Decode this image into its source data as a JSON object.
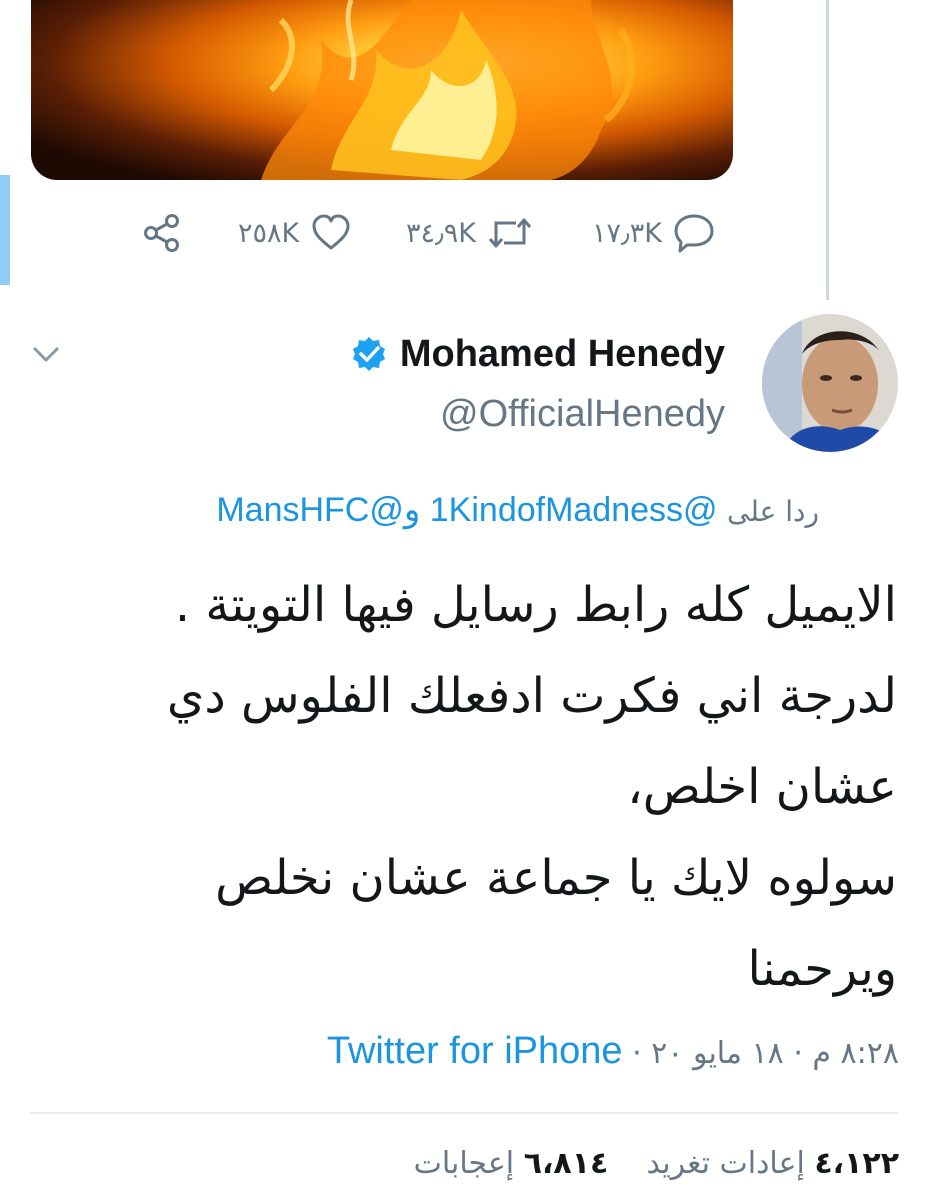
{
  "colors": {
    "link": "#1b95e0",
    "secondary_text": "#657786",
    "primary_text": "#14171a",
    "verified": "#1da1f2",
    "divider": "#e6ecf0"
  },
  "previous_tweet": {
    "media": {
      "icon": "fire-image"
    },
    "actions": {
      "reply": {
        "icon": "reply-icon",
        "count": "١٧٫٣K"
      },
      "retweet": {
        "icon": "retweet-icon",
        "count": "٣٤٫٩K"
      },
      "like": {
        "icon": "heart-icon",
        "count": "٢٥٨K"
      },
      "share": {
        "icon": "share-icon"
      }
    }
  },
  "tweet": {
    "author": {
      "display_name": "Mohamed Henedy",
      "handle": "@OfficialHenedy",
      "verified_icon": "verified-badge-icon",
      "avatar_icon": "avatar-photo"
    },
    "menu_icon": "chevron-down-icon",
    "replying_to": {
      "prefix": "ردا على",
      "mention_1": "@1KindofMadness",
      "conjunction": "و",
      "mention_2": "@MansHFC"
    },
    "text_lines": [
      "الايميل كله رابط رسايل فيها التويتة .",
      "لدرجة اني فكرت ادفعلك الفلوس دي",
      "عشان اخلص،",
      "سولوه لايك يا جماعة عشان نخلص",
      "ويرحمنا"
    ],
    "time": "٨:٢٨ م",
    "separator": "·",
    "date": "١٨ مايو ٢٠",
    "source": "Twitter for iPhone",
    "stats": {
      "retweets_count": "٤،١٢٢",
      "retweets_label": "إعادات تغريد",
      "likes_count": "٦،٨١٤",
      "likes_label": "إعجابات"
    }
  }
}
